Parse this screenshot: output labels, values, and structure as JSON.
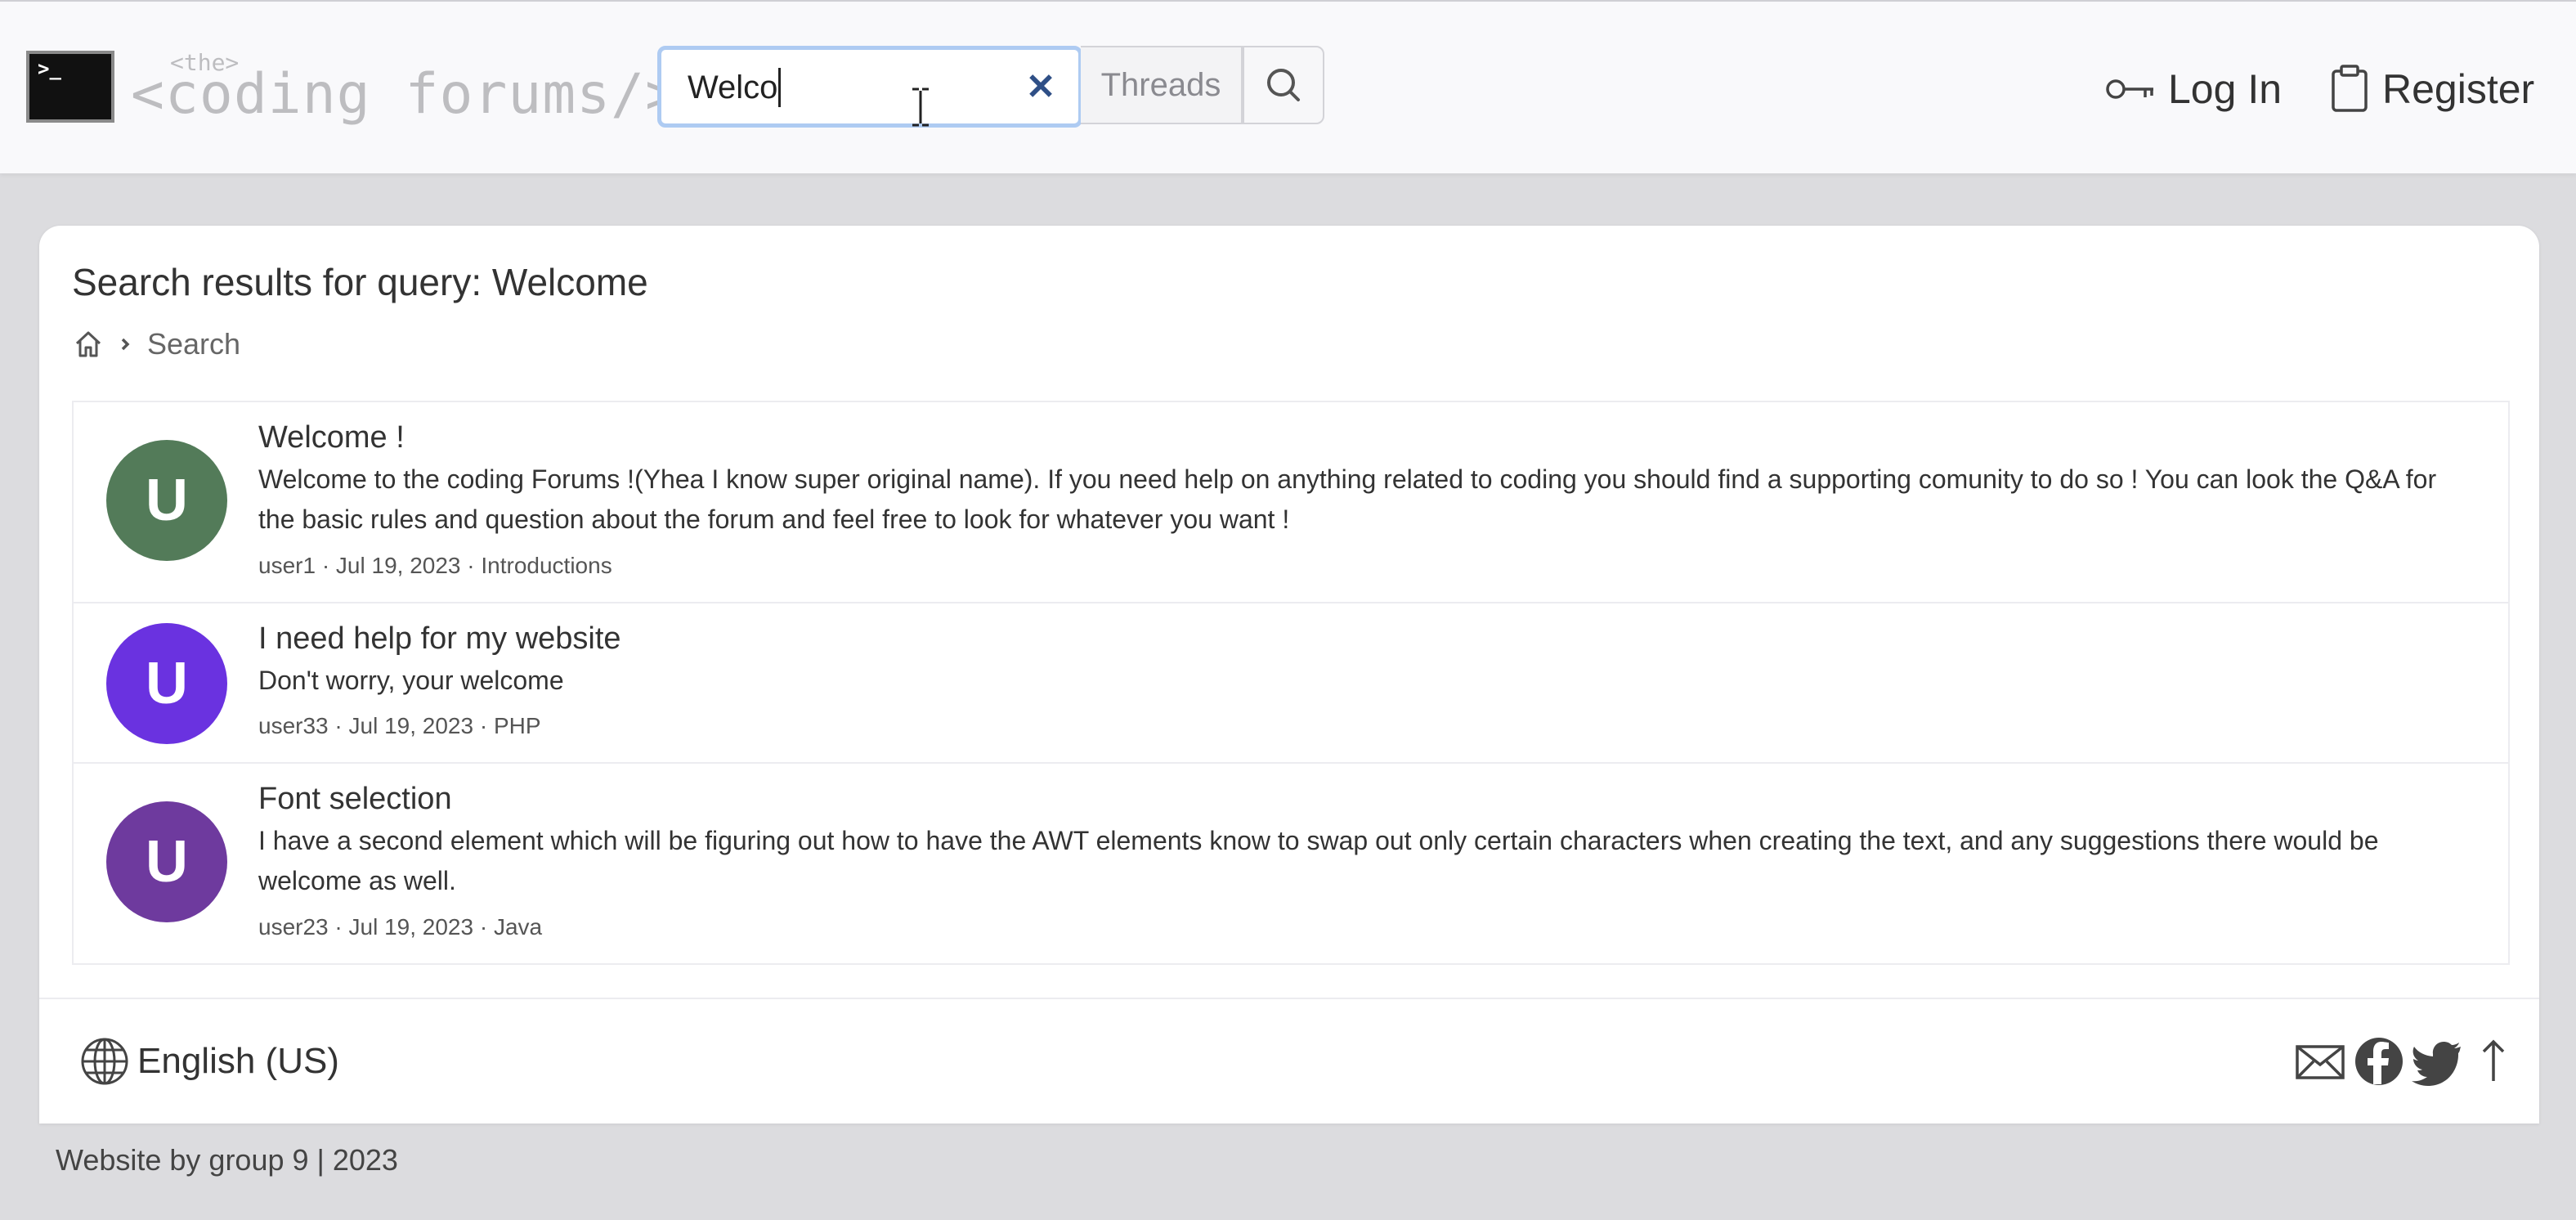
{
  "header": {
    "logo_prompt": ">_",
    "logo_small": "<the>",
    "logo_text": "<coding forums/>",
    "search_value": "Welco",
    "search_scope": "Threads",
    "login_label": "Log In",
    "register_label": "Register"
  },
  "page": {
    "title": "Search results for query: Welcome",
    "breadcrumb_current": "Search"
  },
  "results": [
    {
      "avatar_letter": "U",
      "avatar_color": "#537b59",
      "title": "Welcome !",
      "snippet": "Welcome to the coding Forums !(Yhea I know super original name). If you need help on anything related to coding you should find a supporting comunity to do so ! You can look the Q&A for the basic rules and question about the forum and feel free to look for whatever you want !",
      "meta": "user1 · Jul 19, 2023 · Introductions"
    },
    {
      "avatar_letter": "U",
      "avatar_color": "#6a32e0",
      "title": "I need help for my website",
      "snippet": "Don't worry, your welcome",
      "meta": "user33 · Jul 19, 2023 · PHP"
    },
    {
      "avatar_letter": "U",
      "avatar_color": "#6e3a9e",
      "title": "Font selection",
      "snippet": "I have a second element which will be figuring out how to have the AWT elements know to swap out only certain characters when creating the text, and any suggestions there would be welcome as well.",
      "meta": "user23 · Jul 19, 2023 · Java"
    }
  ],
  "footer": {
    "language": "English (US)",
    "copyright": "Website by group 9 | 2023"
  },
  "icons": [
    "terminal-icon",
    "clear-icon",
    "search-icon",
    "key-icon",
    "clipboard-icon",
    "home-icon",
    "chevron-right-icon",
    "globe-icon",
    "mail-icon",
    "facebook-icon",
    "twitter-icon",
    "arrow-up-icon"
  ]
}
